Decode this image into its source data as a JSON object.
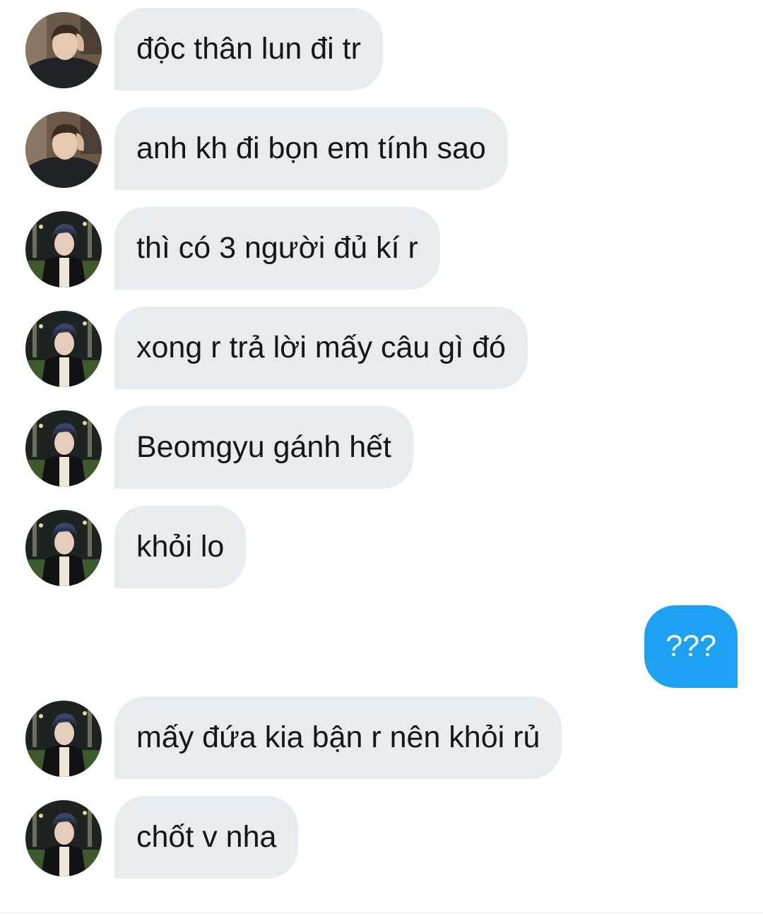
{
  "messages": [
    {
      "text": "độc thân lun đi tr",
      "direction": "in",
      "avatar": "avatar-a"
    },
    {
      "text": "anh kh đi bọn em tính sao",
      "direction": "in",
      "avatar": "avatar-a"
    },
    {
      "text": "thì có 3 người đủ kí r",
      "direction": "in",
      "avatar": "avatar-b"
    },
    {
      "text": "xong r trả lời mấy câu gì đó",
      "direction": "in",
      "avatar": "avatar-b"
    },
    {
      "text": "Beomgyu gánh hết",
      "direction": "in",
      "avatar": "avatar-b"
    },
    {
      "text": "khỏi lo",
      "direction": "in",
      "avatar": "avatar-b"
    },
    {
      "text": "???",
      "direction": "out"
    },
    {
      "text": "mấy đứa kia bận r nên khỏi rủ",
      "direction": "in",
      "avatar": "avatar-b"
    },
    {
      "text": "chốt v nha",
      "direction": "in",
      "avatar": "avatar-b"
    }
  ],
  "colors": {
    "incoming_bubble": "#e6ecf0",
    "outgoing_bubble": "#1da1f2",
    "text": "#14171a"
  }
}
